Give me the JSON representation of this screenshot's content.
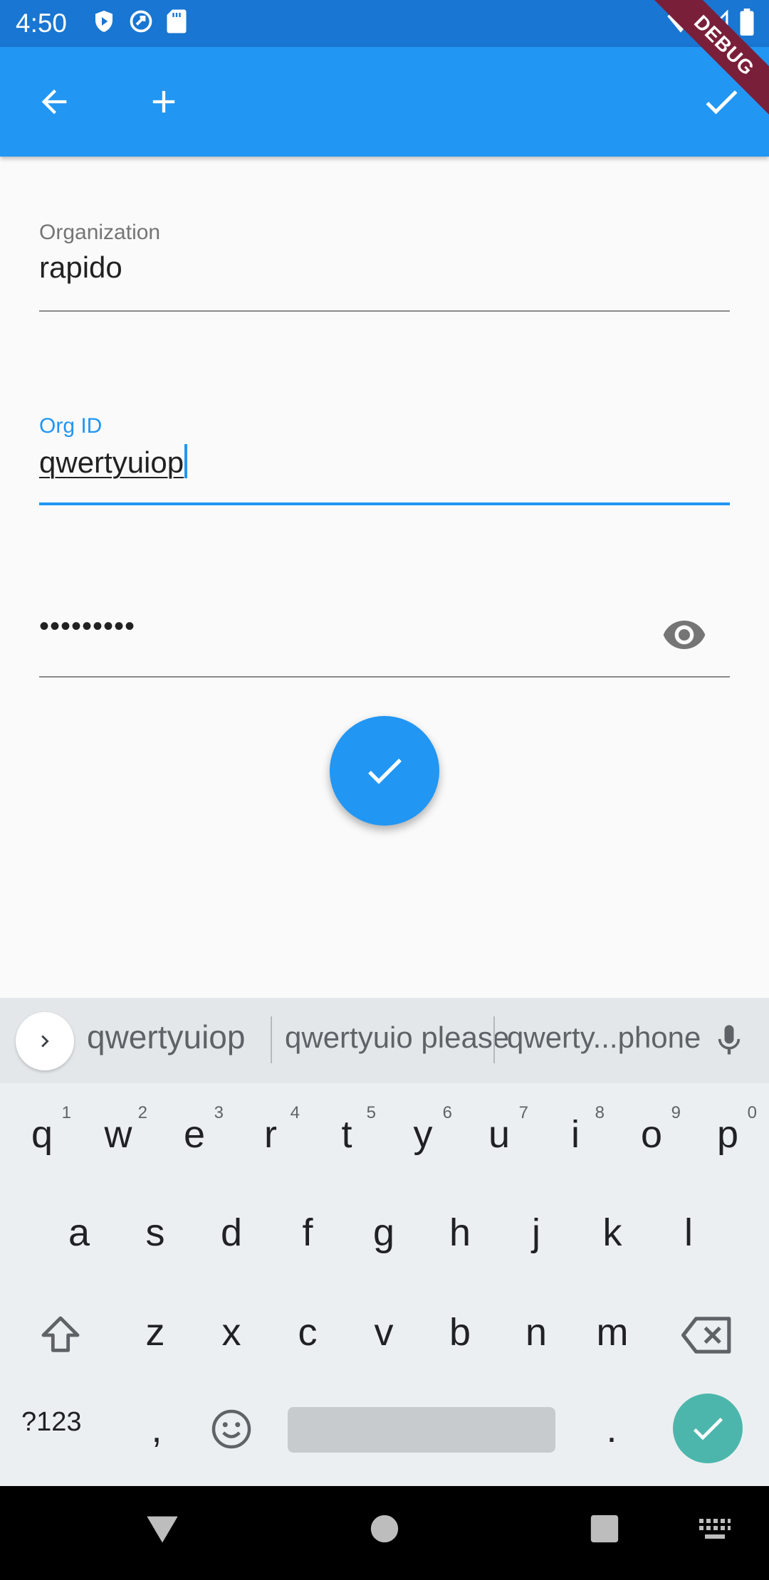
{
  "status_bar": {
    "time": "4:50"
  },
  "debug_banner": "DEBUG",
  "form": {
    "organization": {
      "label": "Organization",
      "value": "rapido"
    },
    "org_id": {
      "label": "Org ID",
      "value": "qwertyuiop"
    },
    "password": {
      "value": "•••••••••"
    }
  },
  "keyboard": {
    "suggestions": [
      "qwertyuiop",
      "qwertyuio please",
      "qwerty...phone"
    ],
    "row1": [
      {
        "k": "q",
        "h": "1"
      },
      {
        "k": "w",
        "h": "2"
      },
      {
        "k": "e",
        "h": "3"
      },
      {
        "k": "r",
        "h": "4"
      },
      {
        "k": "t",
        "h": "5"
      },
      {
        "k": "y",
        "h": "6"
      },
      {
        "k": "u",
        "h": "7"
      },
      {
        "k": "i",
        "h": "8"
      },
      {
        "k": "o",
        "h": "9"
      },
      {
        "k": "p",
        "h": "0"
      }
    ],
    "row2": [
      "a",
      "s",
      "d",
      "f",
      "g",
      "h",
      "j",
      "k",
      "l"
    ],
    "row3": [
      "z",
      "x",
      "c",
      "v",
      "b",
      "n",
      "m"
    ],
    "symbols_label": "?123",
    "comma": ",",
    "period": "."
  },
  "colors": {
    "primary": "#2196f3",
    "status_bar": "#1976d2",
    "enter_key": "#4db6ac",
    "debug": "#7a1f3a"
  }
}
